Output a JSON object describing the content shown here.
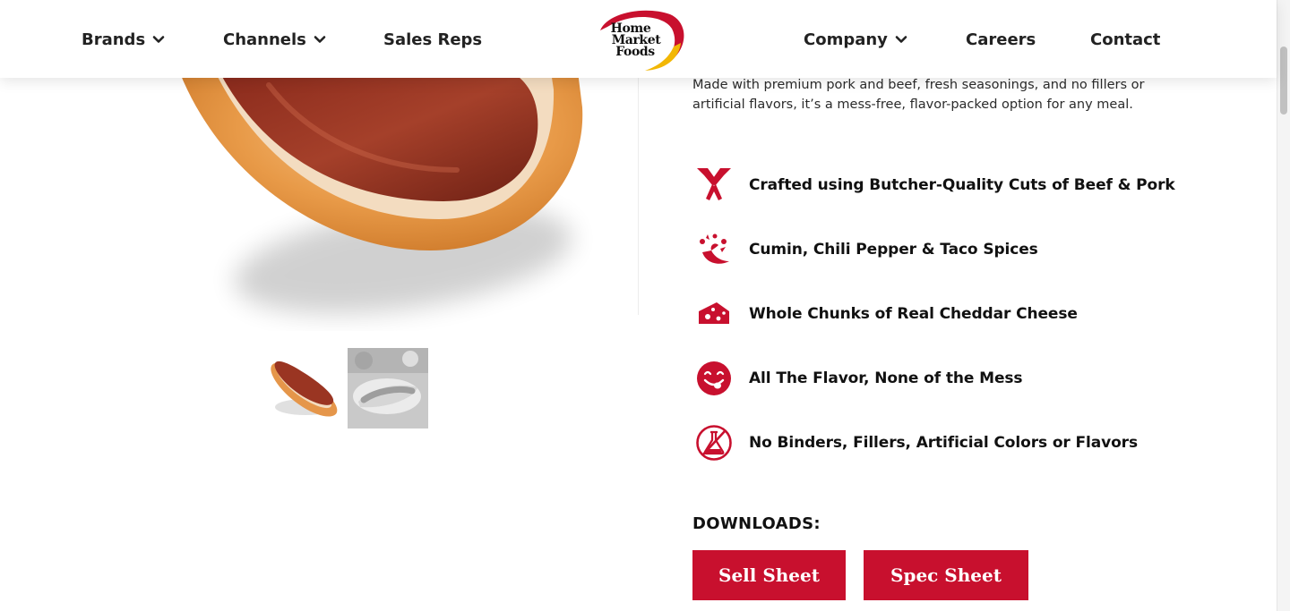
{
  "nav": {
    "brands": "Brands",
    "channels": "Channels",
    "sales_reps": "Sales Reps",
    "company": "Company",
    "careers": "Careers",
    "contact": "Contact"
  },
  "logo": {
    "line1": "Home",
    "line2": "Market",
    "line3": "Foods"
  },
  "product": {
    "description": "Made with premium pork and beef, fresh seasonings, and no fillers or artificial flavors, it’s a mess-free, flavor-packed option for any meal."
  },
  "features": [
    {
      "icon": "cleaver-icon",
      "text": "Crafted using Butcher-Quality Cuts of Beef & Pork"
    },
    {
      "icon": "chili-pepper-icon",
      "text": "Cumin, Chili Pepper & Taco Spices"
    },
    {
      "icon": "cheese-icon",
      "text": "Whole Chunks of Real Cheddar Cheese"
    },
    {
      "icon": "yum-face-icon",
      "text": "All The Flavor, None of the Mess"
    },
    {
      "icon": "no-additives-icon",
      "text": "No Binders, Fillers, Artificial Colors or Flavors"
    }
  ],
  "downloads": {
    "title": "DOWNLOADS:",
    "sell_sheet": "Sell Sheet",
    "spec_sheet": "Spec Sheet"
  },
  "colors": {
    "accent": "#c8102e",
    "logo_yellow": "#f2b705",
    "text": "#111111"
  }
}
